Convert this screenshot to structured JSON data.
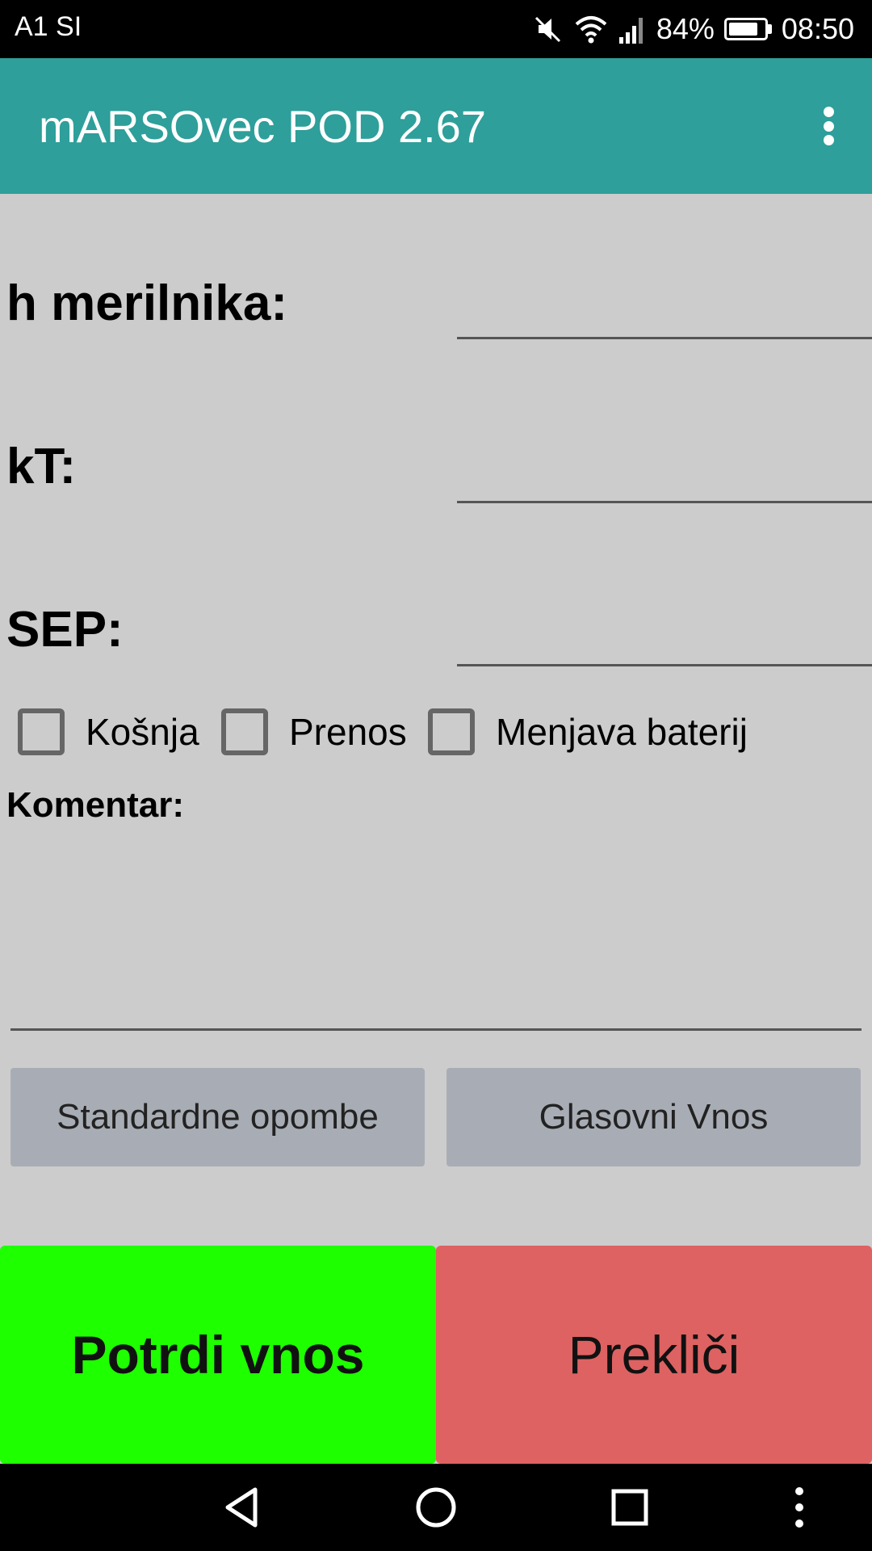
{
  "status_bar": {
    "carrier": "A1 SI",
    "battery_percent": "84%",
    "battery_level": 0.84,
    "time": "08:50",
    "icons": [
      "mute-icon",
      "wifi-icon",
      "signal-icon",
      "battery-icon"
    ]
  },
  "app_bar": {
    "title": "mARSOvec POD 2.67",
    "menu_icon": "overflow-menu-icon"
  },
  "form": {
    "fields": [
      {
        "label": "h merilnika:",
        "value": ""
      },
      {
        "label": "kT:",
        "value": ""
      },
      {
        "label": "SEP:",
        "value": ""
      }
    ],
    "checkboxes": [
      {
        "label": "Košnja",
        "checked": false
      },
      {
        "label": "Prenos",
        "checked": false
      },
      {
        "label": "Menjava baterij",
        "checked": false
      }
    ],
    "comment_label": "Komentar:",
    "comment_value": ""
  },
  "buttons": {
    "standard_notes": "Standardne opombe",
    "voice_input": "Glasovni Vnos",
    "confirm": "Potrdi vnos",
    "cancel": "Prekliči"
  },
  "colors": {
    "app_bar": "#2e9f9a",
    "background": "#cccccc",
    "confirm": "#1eff00",
    "cancel": "#de6262",
    "secondary_button": "#a8adb5"
  },
  "nav_bar": {
    "icons": [
      "back-icon",
      "home-icon",
      "recents-icon",
      "more-icon"
    ]
  }
}
